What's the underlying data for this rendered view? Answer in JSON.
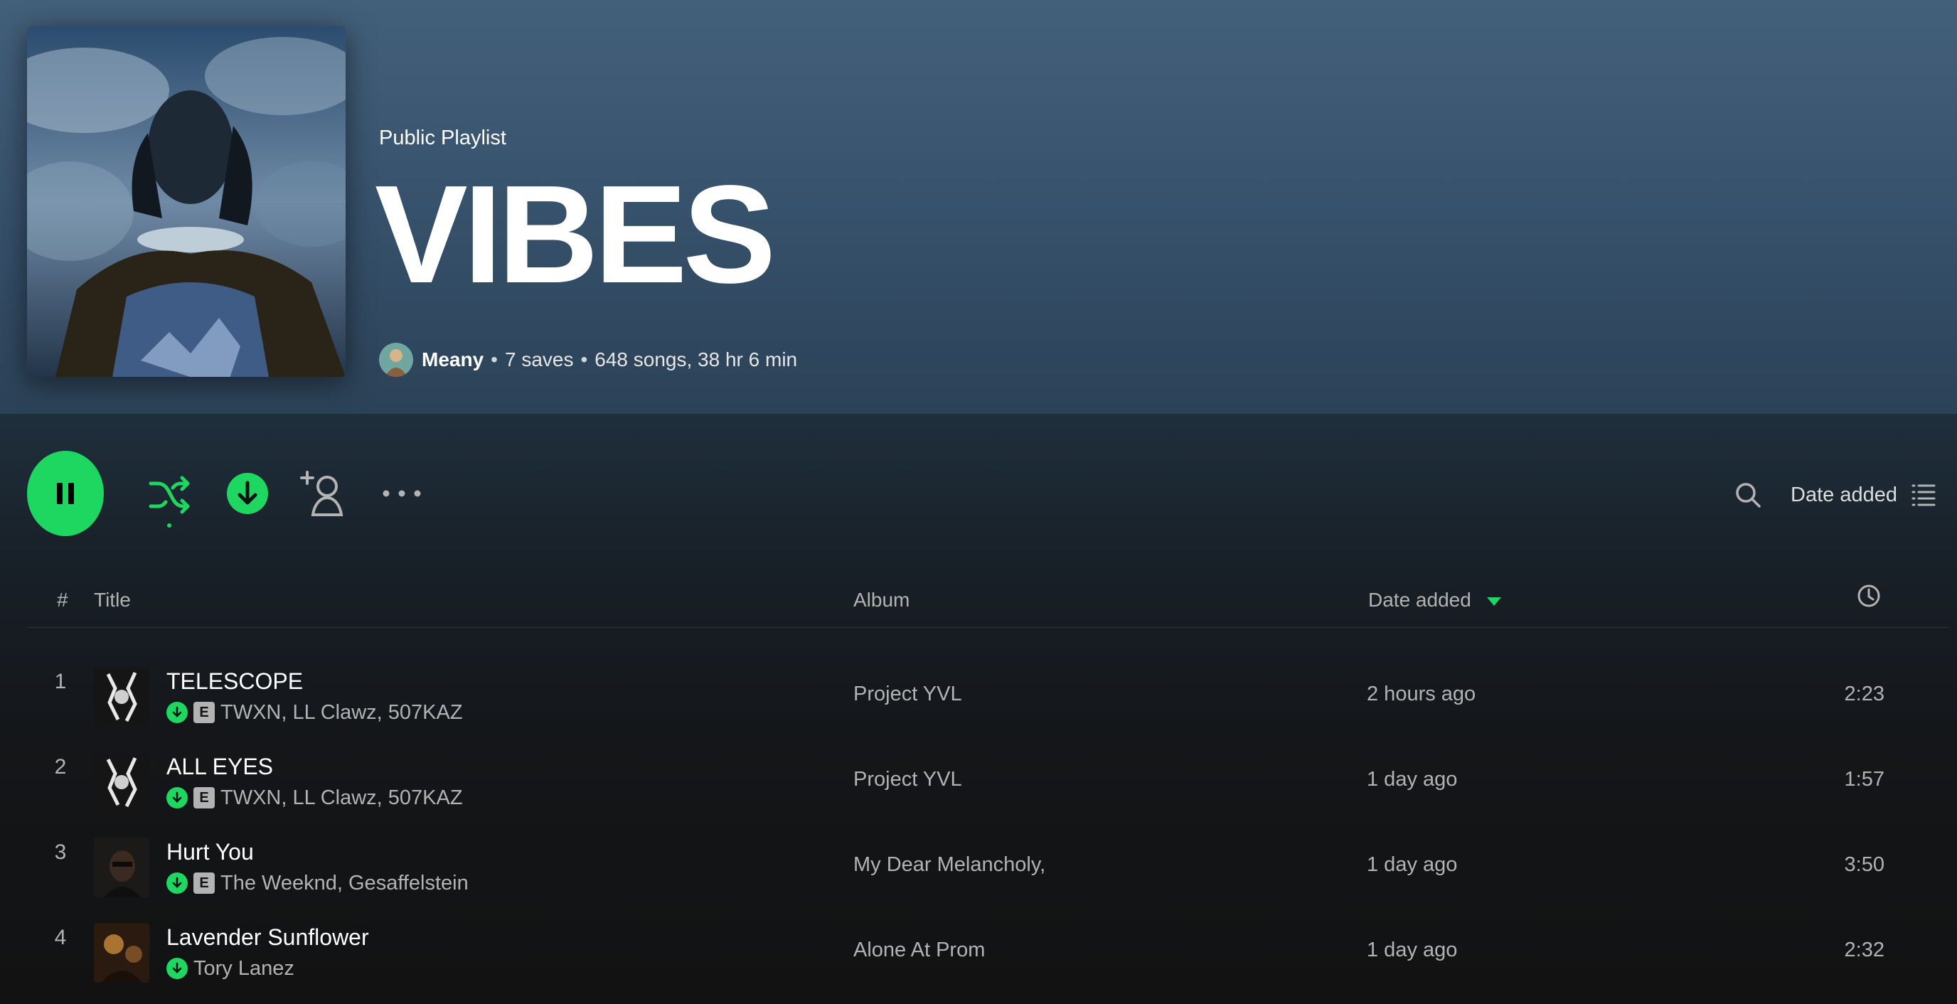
{
  "colors": {
    "accent": "#1ed760",
    "header": "#3f5a73",
    "background": "#121212",
    "muted": "#b3b3b3"
  },
  "playlist": {
    "type_label": "Public Playlist",
    "title": "VIBES",
    "owner": "Meany",
    "saves": "7 saves",
    "stats": "648 songs, 38 hr 6 min",
    "separator": "•"
  },
  "controls": {
    "play_state": "playing",
    "icons": [
      "pause-icon",
      "shuffle-icon",
      "download-icon",
      "add-collaborator-icon",
      "more-options-icon",
      "search-icon",
      "list-view-icon"
    ],
    "sort_label": "Date added"
  },
  "table": {
    "headers": {
      "num": "#",
      "title": "Title",
      "album": "Album",
      "date_added": "Date added"
    },
    "rows": [
      {
        "num": "1",
        "title": "TELESCOPE",
        "artists": "TWXN, LL Clawz, 507KAZ",
        "explicit": "E",
        "album": "Project YVL",
        "date_added": "2 hours ago",
        "duration": "2:23"
      },
      {
        "num": "2",
        "title": "ALL EYES",
        "artists": "TWXN, LL Clawz, 507KAZ",
        "explicit": "E",
        "album": "Project YVL",
        "date_added": "1 day ago",
        "duration": "1:57"
      },
      {
        "num": "3",
        "title": "Hurt You",
        "artists": "The Weeknd, Gesaffelstein",
        "explicit": "E",
        "album": "My Dear Melancholy,",
        "date_added": "1 day ago",
        "duration": "3:50"
      },
      {
        "num": "4",
        "title": "Lavender Sunflower",
        "artists": "Tory Lanez",
        "explicit": "",
        "album": "Alone At Prom",
        "date_added": "1 day ago",
        "duration": "2:32"
      }
    ]
  }
}
